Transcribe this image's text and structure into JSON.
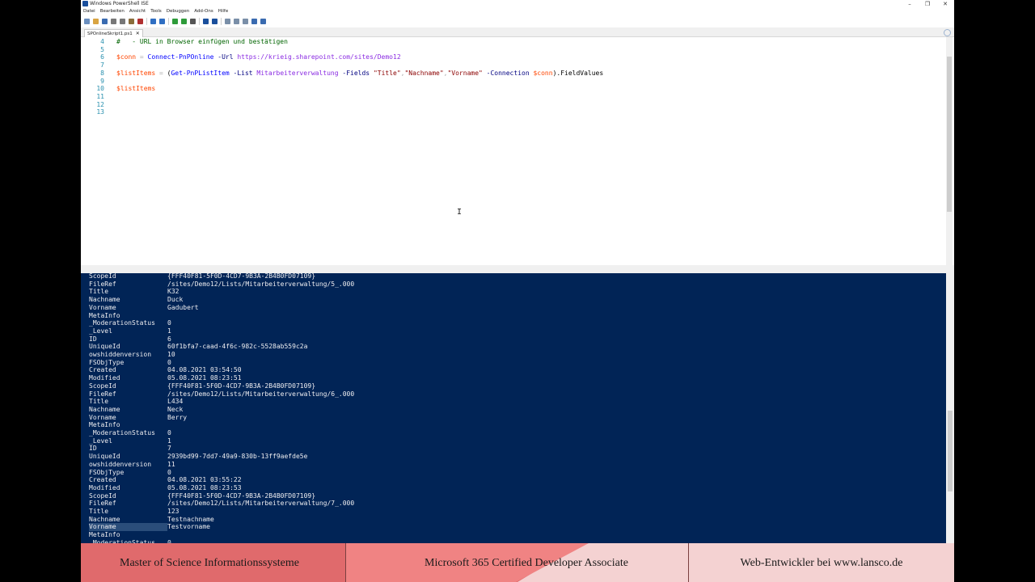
{
  "window": {
    "title": "Windows PowerShell ISE",
    "controls": [
      "–",
      "❐",
      "✕"
    ]
  },
  "menu": [
    "Datei",
    "Bearbeiten",
    "Ansicht",
    "Tools",
    "Debuggen",
    "Add-Ons",
    "Hilfe"
  ],
  "toolbar": {
    "icons": [
      "new-file-icon",
      "open-icon",
      "save-icon",
      "cut-icon",
      "copy-icon",
      "paste-icon",
      "clear-icon",
      "undo-icon",
      "redo-icon",
      "run-icon",
      "run-selection-icon",
      "stop-icon",
      "remote-icon",
      "powershell-icon",
      "layout-top-icon",
      "layout-right-icon",
      "layout-max-icon",
      "show-script-icon",
      "commands-icon"
    ]
  },
  "tab": {
    "label": "SPOnlineSkript1.ps1",
    "close": "✕"
  },
  "editor": {
    "lines": [
      {
        "n": "4",
        "tokens": [
          {
            "t": "#   - URL in Browser einfügen und bestätigen",
            "c": "c-comment"
          }
        ]
      },
      {
        "n": "5",
        "tokens": []
      },
      {
        "n": "6",
        "tokens": [
          {
            "t": "$conn",
            "c": "c-var"
          },
          {
            "t": " = ",
            "c": "c-op"
          },
          {
            "t": "Connect-PnPOnline",
            "c": "c-cmd"
          },
          {
            "t": " -Url ",
            "c": "c-param"
          },
          {
            "t": "https://krieig.sharepoint.com/sites/Demo12",
            "c": "c-arg"
          }
        ]
      },
      {
        "n": "7",
        "tokens": []
      },
      {
        "n": "8",
        "tokens": [
          {
            "t": "$listItems",
            "c": "c-var"
          },
          {
            "t": " = ",
            "c": "c-op"
          },
          {
            "t": "(",
            "c": "c-plain"
          },
          {
            "t": "Get-PnPListItem",
            "c": "c-cmd"
          },
          {
            "t": " -List ",
            "c": "c-param"
          },
          {
            "t": "Mitarbeiterverwaltung",
            "c": "c-arg"
          },
          {
            "t": " -Fields ",
            "c": "c-param"
          },
          {
            "t": "\"Title\"",
            "c": "c-str"
          },
          {
            "t": ",",
            "c": "c-op"
          },
          {
            "t": "\"Nachname\"",
            "c": "c-str"
          },
          {
            "t": ",",
            "c": "c-op"
          },
          {
            "t": "\"Vorname\"",
            "c": "c-str"
          },
          {
            "t": " -Connection ",
            "c": "c-param"
          },
          {
            "t": "$conn",
            "c": "c-var"
          },
          {
            "t": ").FieldValues",
            "c": "c-plain"
          }
        ]
      },
      {
        "n": "9",
        "tokens": []
      },
      {
        "n": "10",
        "tokens": [
          {
            "t": "$listItems",
            "c": "c-var"
          }
        ]
      },
      {
        "n": "11",
        "tokens": []
      },
      {
        "n": "12",
        "tokens": []
      },
      {
        "n": "13",
        "tokens": []
      }
    ],
    "cursor": "I"
  },
  "console": {
    "rows": [
      {
        "k": "ScopeId",
        "v": "{FFF40F81-5F0D-4CD7-9B3A-2B4B0FD07109}"
      },
      {
        "k": "FileRef",
        "v": "/sites/Demo12/Lists/Mitarbeiterverwaltung/5_.000"
      },
      {
        "k": "Title",
        "v": "K32"
      },
      {
        "k": "Nachname",
        "v": "Duck"
      },
      {
        "k": "Vorname",
        "v": "Gadubert"
      },
      {
        "k": "MetaInfo",
        "v": ""
      },
      {
        "k": "_ModerationStatus",
        "v": "0"
      },
      {
        "k": "_Level",
        "v": "1"
      },
      {
        "k": "ID",
        "v": "6"
      },
      {
        "k": "UniqueId",
        "v": "60f1bfa7-caad-4f6c-982c-5528ab559c2a"
      },
      {
        "k": "owshiddenversion",
        "v": "10"
      },
      {
        "k": "FSObjType",
        "v": "0"
      },
      {
        "k": "Created",
        "v": "04.08.2021 03:54:50"
      },
      {
        "k": "Modified",
        "v": "05.08.2021 08:23:51"
      },
      {
        "k": "ScopeId",
        "v": "{FFF40F81-5F0D-4CD7-9B3A-2B4B0FD07109}"
      },
      {
        "k": "FileRef",
        "v": "/sites/Demo12/Lists/Mitarbeiterverwaltung/6_.000"
      },
      {
        "k": "Title",
        "v": "L434"
      },
      {
        "k": "Nachname",
        "v": "Neck"
      },
      {
        "k": "Vorname",
        "v": "Berry"
      },
      {
        "k": "MetaInfo",
        "v": ""
      },
      {
        "k": "_ModerationStatus",
        "v": "0"
      },
      {
        "k": "_Level",
        "v": "1"
      },
      {
        "k": "ID",
        "v": "7"
      },
      {
        "k": "UniqueId",
        "v": "2939bd99-7dd7-49a9-830b-13ff9aefde5e"
      },
      {
        "k": "owshiddenversion",
        "v": "11"
      },
      {
        "k": "FSObjType",
        "v": "0"
      },
      {
        "k": "Created",
        "v": "04.08.2021 03:55:22"
      },
      {
        "k": "Modified",
        "v": "05.08.2021 08:23:53"
      },
      {
        "k": "ScopeId",
        "v": "{FFF40F81-5F0D-4CD7-9B3A-2B4B0FD07109}"
      },
      {
        "k": "FileRef",
        "v": "/sites/Demo12/Lists/Mitarbeiterverwaltung/7_.000"
      },
      {
        "k": "Title",
        "v": "123"
      },
      {
        "k": "Nachname",
        "v": "Testnachname"
      },
      {
        "k": "Vorname",
        "v": "Testvorname",
        "selected": true
      },
      {
        "k": "MetaInfo",
        "v": ""
      },
      {
        "k": "_ModerationStatus",
        "v": "0"
      }
    ]
  },
  "banner": {
    "left": "Master of Science Informationssysteme",
    "center": "Microsoft 365 Certified Developer Associate",
    "right": "Web-Entwickler bei www.lansco.de"
  },
  "colors": {
    "console_bg": "#012456",
    "banner_red": "#e06a6c",
    "banner_light": "#f4d2d2"
  }
}
